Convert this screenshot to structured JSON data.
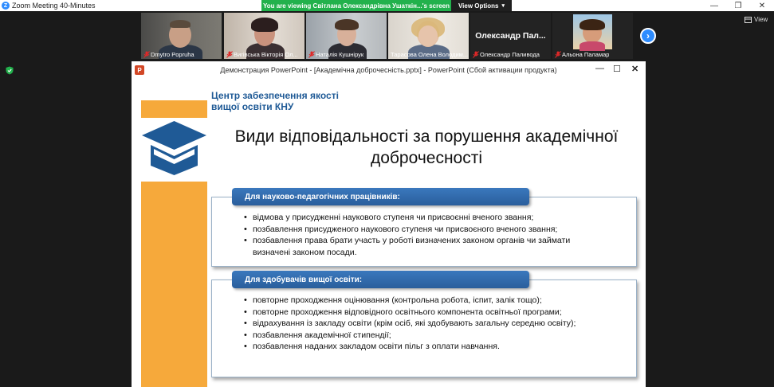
{
  "window": {
    "title": "Zoom Meeting 40-Minutes",
    "viewing_banner": "You are viewing Світлана Олександрівна Ушаткін...'s screen",
    "view_options": "View Options",
    "view_label": "View"
  },
  "participants": [
    {
      "name": "Dmytro Popruha"
    },
    {
      "name": "Вигівська Вікторія Ол..."
    },
    {
      "name": "Наталія Кушнірук"
    },
    {
      "name": "Тарасова Олена Володим..."
    },
    {
      "name": "Олександр Паливода",
      "display": "Олександр Пал..."
    },
    {
      "name": "Альона Паламар"
    }
  ],
  "ppt": {
    "window_title": "Демонстрация PowerPoint - [Академічна доброчесність.pptx] - PowerPoint (Сбой активации продукта)",
    "slide": {
      "center_name_line1": "Центр забезпечення  якості",
      "center_name_line2": "вищої освіти КНУ",
      "title_line1": "Види відповідальності за порушення академічної",
      "title_line2": "доброчесності",
      "section1": {
        "header": "Для  науково-педагогічних працівників:",
        "items": [
          "відмова у присудженні наукового ступеня чи присвоєнні вченого звання;",
          "позбавлення присудженого наукового ступеня чи присвоєного вченого звання;",
          "позбавлення права брати участь у роботі визначених законом органів чи займати визначені законом посади."
        ]
      },
      "section2": {
        "header": "Для здобувачів вищої освіти:",
        "items": [
          "повторне проходження оцінювання (контрольна робота, іспит, залік тощо);",
          " повторне проходження відповідного освітнього компонента освітньої програми;",
          "відрахування із закладу освіти (крім осіб, які здобувають загальну середню освіту);",
          "позбавлення академічної стипендії;",
          "позбавлення наданих закладом освіти пільг з оплати навчання."
        ]
      }
    }
  },
  "colors": {
    "zoom_blue": "#2d8cff",
    "banner_green": "#22b14c",
    "slide_orange": "#f6a93b",
    "slide_blue": "#2a5e9c",
    "mic_muted_red": "#e02828"
  }
}
